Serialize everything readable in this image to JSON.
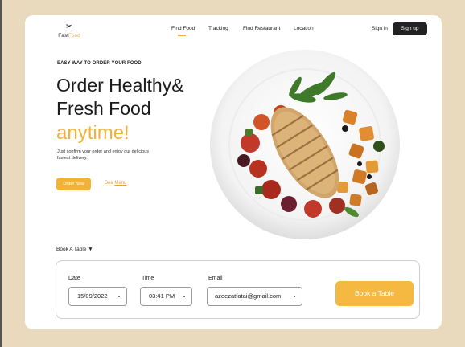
{
  "logo": {
    "mark": "✂",
    "word_a": "Fast",
    "word_b": "Food"
  },
  "nav": {
    "items": [
      {
        "label": "Find Food"
      },
      {
        "label": "Tracking"
      },
      {
        "label": "Find Restaurant"
      },
      {
        "label": "Location"
      }
    ]
  },
  "auth": {
    "signin": "Sign in",
    "signup": "Sign up"
  },
  "hero": {
    "eyebrow": "EASY WAY TO ORDER YOUR FOOD",
    "line1": "Order Healthy&",
    "line2": "Fresh Food",
    "accent": "anytime!",
    "subtext": "Just confirm your order and enjoy our delicious fastest delivery.",
    "order_btn": "Order Now",
    "see_menu_a": "See ",
    "see_menu_b": "Menu"
  },
  "book": {
    "title": "Book A Table",
    "toggle": "▼",
    "date_label": "Date",
    "date_value": "15/09/2022",
    "time_label": "Time",
    "time_value": "03:41 PM",
    "email_label": "Email",
    "email_value": "azeezatfatai@gmail.com",
    "chevron": "⌄",
    "button": "Book a Table"
  },
  "colors": {
    "accent": "#f2b23a",
    "background": "#e9d9bd",
    "dark": "#222222"
  }
}
